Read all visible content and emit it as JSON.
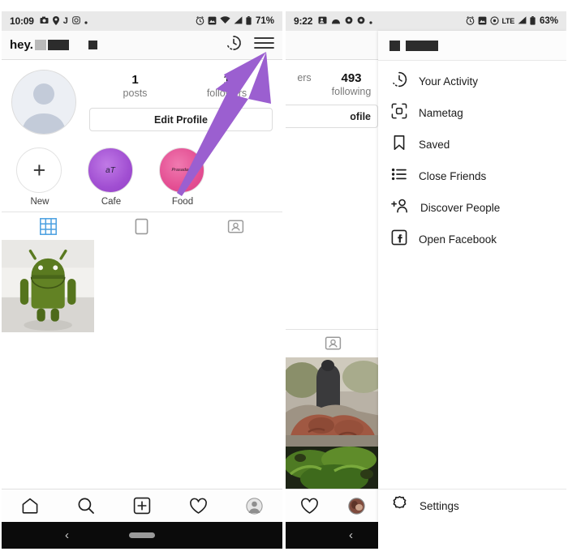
{
  "left_phone": {
    "status_bar": {
      "time": "10:09",
      "left_icons": [
        "camera-icon",
        "location-icon",
        "j-letter-icon",
        "instagram-icon",
        "dot-icon"
      ],
      "right_icons": [
        "alarm-icon",
        "screenshot-icon",
        "wifi-icon",
        "signal-icon",
        "battery-icon"
      ],
      "battery": "71%"
    },
    "header": {
      "username_prefix": "hey.",
      "icons": [
        "history-icon",
        "hamburger-menu-icon"
      ]
    },
    "profile": {
      "stats": [
        {
          "number": "1",
          "label": "posts"
        },
        {
          "number": "1",
          "label": "followers"
        }
      ],
      "edit_profile_label": "Edit Profile"
    },
    "highlights": [
      {
        "label": "New",
        "glyph": "+",
        "color": "#ffffff"
      },
      {
        "label": "Cafe",
        "glyph": "aT",
        "color": "#A855D8"
      },
      {
        "label": "Food",
        "glyph": "Prasadam",
        "color": "#E8559A"
      }
    ],
    "tabs": [
      {
        "name": "grid-tab",
        "active": true
      },
      {
        "name": "reels-tab",
        "active": false
      },
      {
        "name": "tagged-tab",
        "active": false
      }
    ],
    "bottom_nav": [
      "home-icon",
      "search-icon",
      "add-post-icon",
      "activity-heart-icon",
      "profile-avatar-icon"
    ],
    "system_nav": [
      "back-icon",
      "home-pill-icon"
    ]
  },
  "right_phone": {
    "status_bar": {
      "time": "9:22",
      "left_icons": [
        "contacts-icon",
        "cloud-icon",
        "gear-icon",
        "gear-icon",
        "dot-icon"
      ],
      "right_icons": [
        "alarm-icon",
        "screenshot-icon",
        "hotspot-icon",
        "signal-icon",
        "battery-icon"
      ],
      "network": "LTE",
      "battery": "63%"
    },
    "header": {
      "icons": [
        "history-icon",
        "hamburger-menu-icon"
      ]
    },
    "profile": {
      "stats": [
        {
          "number": "",
          "label": "ers"
        },
        {
          "number": "493",
          "label": "following"
        }
      ],
      "edit_profile_label": "ofile"
    },
    "drawer": {
      "items": [
        {
          "label": "Your Activity",
          "icon": "activity-clock-icon"
        },
        {
          "label": "Nametag",
          "icon": "nametag-icon"
        },
        {
          "label": "Saved",
          "icon": "bookmark-icon"
        },
        {
          "label": "Close Friends",
          "icon": "list-icon"
        },
        {
          "label": "Discover People",
          "icon": "add-person-icon"
        },
        {
          "label": "Open Facebook",
          "icon": "facebook-icon"
        }
      ],
      "settings": {
        "label": "Settings",
        "icon": "gear-icon"
      }
    },
    "bottom_nav": [
      "activity-heart-icon",
      "profile-avatar-icon"
    ],
    "system_nav": [
      "back-icon",
      "home-pill-icon"
    ]
  },
  "annotations": {
    "accent_color": "#9B5FD0",
    "arrows": [
      {
        "name": "arrow-to-hamburger-menu",
        "points_to": "hamburger-menu-icon"
      },
      {
        "name": "arrow-to-settings",
        "points_to": "settings-menu-item"
      }
    ]
  }
}
